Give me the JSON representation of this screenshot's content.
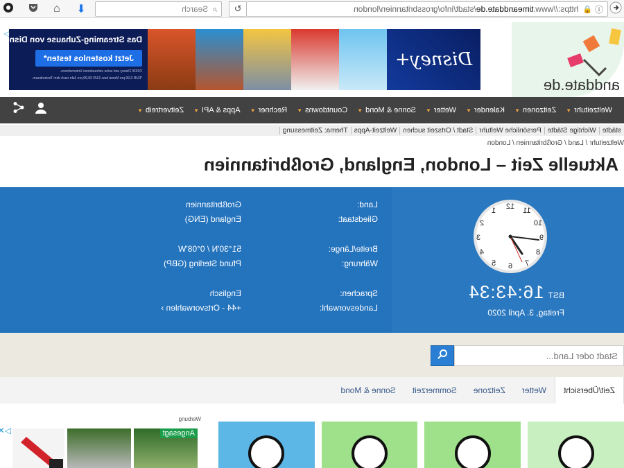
{
  "browser": {
    "url_prefix": "https://www.",
    "url_domain": "timeanddate.de",
    "url_path": "/stadt/info/grossbritannien/london",
    "search_placeholder": "Search"
  },
  "ad_banner": {
    "headline": "Das Streaming-Zuhause von Disney",
    "cta": "Jetzt kostenlos testen*",
    "fineprint_1": "©2020 Disney und seine verbundenen Unternehmen.",
    "fineprint_2": "*EUR 6,99 pro Monat bzw. EUR 69,99 pro Jahr nach dem Testzeitraum.",
    "logo_text": "Disney+"
  },
  "site": {
    "name": "anddate.de"
  },
  "nav": {
    "items": [
      {
        "label": "Weltzeituhr"
      },
      {
        "label": "Zeitzonen"
      },
      {
        "label": "Kalender"
      },
      {
        "label": "Wetter"
      },
      {
        "label": "Sonne & Mond"
      },
      {
        "label": "Countdowns"
      },
      {
        "label": "Rechner"
      },
      {
        "label": "Apps & API"
      },
      {
        "label": "Zeitvertreib"
      }
    ]
  },
  "subnav": {
    "items": [
      "städte",
      "Wichtige Städte",
      "Persönliche Weltuhr",
      "Stadt / Ortszeit suchen",
      "Weltzeit-Apps",
      "Thema: Zeitmessung"
    ]
  },
  "breadcrumb": "Weltzeituhr  /  Land  /  Großbritannien  /  London",
  "page_title": "Aktuelle Zeit – London, England, Großbritannien",
  "clock": {
    "time": "16:43:34",
    "tz": "BST",
    "date": "Freitag, 3. April 2020",
    "numbers": [
      "12",
      "1",
      "2",
      "3",
      "4",
      "5",
      "6",
      "7",
      "8",
      "9",
      "10",
      "11"
    ]
  },
  "facts": {
    "land_label": "Land:",
    "land_value": "Großbritannien",
    "gliedstaat_label": "Gliedstaat:",
    "gliedstaat_value": "England (ENG)",
    "latlon_label": "Breite/Länge:",
    "latlon_value": "51°30'N / 0°08'W",
    "waehrung_label": "Währung:",
    "waehrung_value": "Pfund Sterling (GBP)",
    "sprachen_label": "Sprachen:",
    "sprachen_value": "Englisch",
    "vorwahl_label": "Landesvorwahl:",
    "vorwahl_value": "+44 - Ortsvorwahlen"
  },
  "search": {
    "placeholder": "Stadt oder Land..."
  },
  "tabs": [
    "Zeit/Übersicht",
    "Wetter",
    "Zeitzone",
    "Sommerzeit",
    "Sonne & Mond"
  ],
  "bottom_ad": {
    "label": "Werbung",
    "tag": "Angesagt"
  },
  "colors": {
    "panel": "#2473bd",
    "nav": "#424242",
    "accent": "#e8a040"
  }
}
